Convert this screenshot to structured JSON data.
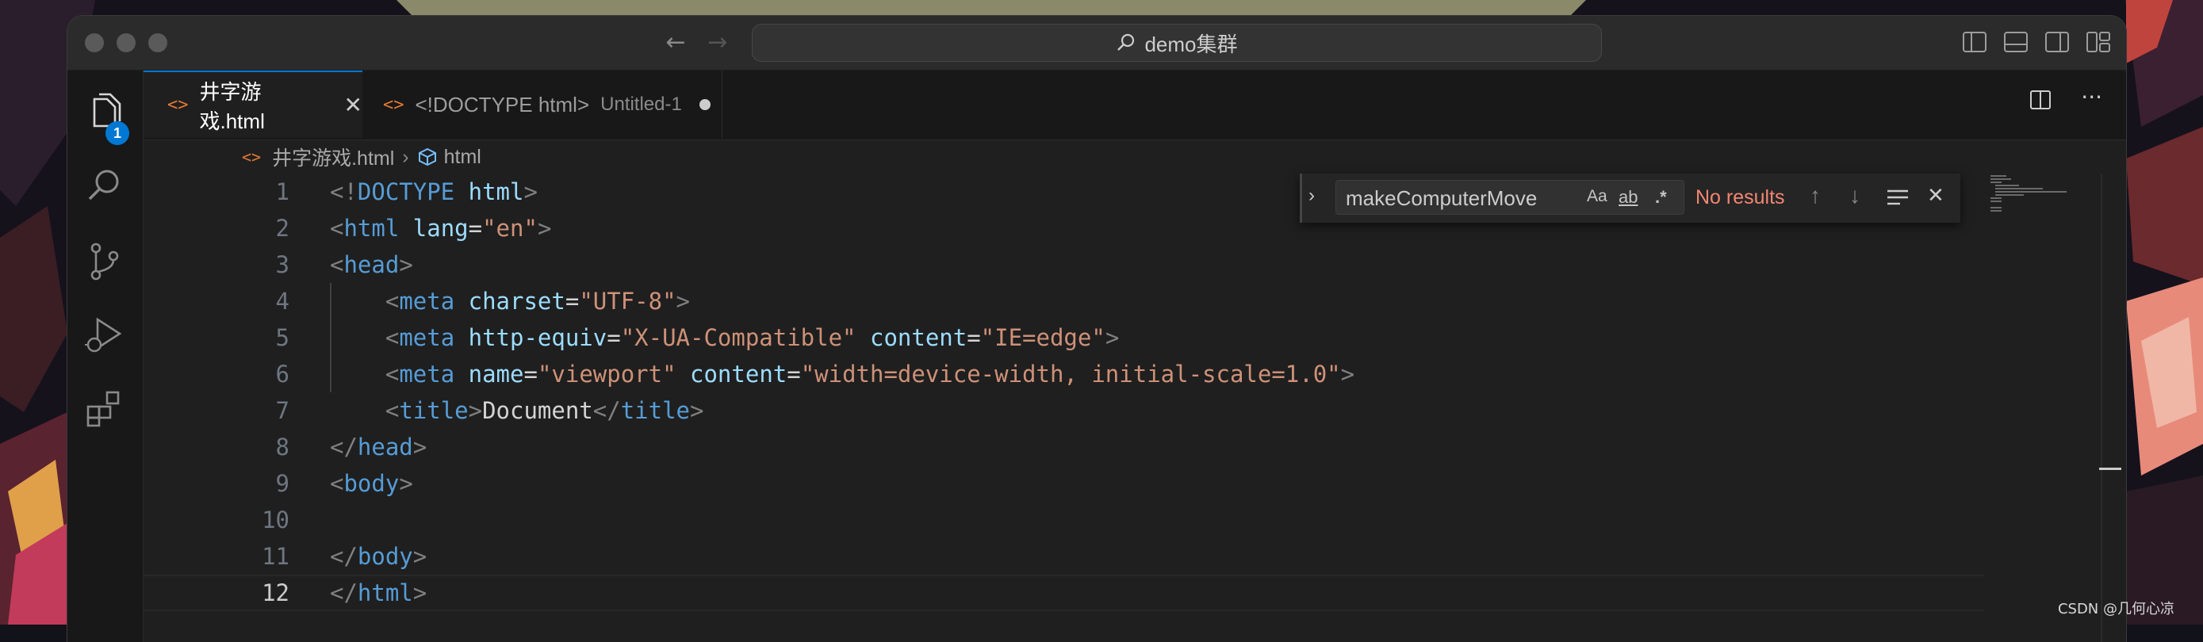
{
  "titlebar": {
    "search_text": "demo集群"
  },
  "activity_bar": {
    "explorer_badge": "1"
  },
  "tabs": [
    {
      "label": "井字游戏.html",
      "active": true,
      "dirty": false
    },
    {
      "label": "<!DOCTYPE html>",
      "description": "Untitled-1",
      "active": false,
      "dirty": true
    }
  ],
  "breadcrumb": {
    "file": "井字游戏.html",
    "symbol": "html"
  },
  "editor": {
    "line_numbers": [
      "1",
      "2",
      "3",
      "4",
      "5",
      "6",
      "7",
      "8",
      "9",
      "10",
      "11",
      "12"
    ],
    "current_line": "12",
    "lines": [
      [
        [
          "punc",
          "<!"
        ],
        [
          "tag",
          "DOCTYPE"
        ],
        [
          "text",
          " "
        ],
        [
          "attr",
          "html"
        ],
        [
          "punc",
          ">"
        ]
      ],
      [
        [
          "punc",
          "<"
        ],
        [
          "tag",
          "html"
        ],
        [
          "text",
          " "
        ],
        [
          "attr",
          "lang"
        ],
        [
          "text",
          "="
        ],
        [
          "str",
          "\"en\""
        ],
        [
          "punc",
          ">"
        ]
      ],
      [
        [
          "punc",
          "<"
        ],
        [
          "tag",
          "head"
        ],
        [
          "punc",
          ">"
        ]
      ],
      [
        [
          "text",
          "    "
        ],
        [
          "punc",
          "<"
        ],
        [
          "tag",
          "meta"
        ],
        [
          "text",
          " "
        ],
        [
          "attr",
          "charset"
        ],
        [
          "text",
          "="
        ],
        [
          "str",
          "\"UTF-8\""
        ],
        [
          "punc",
          ">"
        ]
      ],
      [
        [
          "text",
          "    "
        ],
        [
          "punc",
          "<"
        ],
        [
          "tag",
          "meta"
        ],
        [
          "text",
          " "
        ],
        [
          "attr",
          "http-equiv"
        ],
        [
          "text",
          "="
        ],
        [
          "str",
          "\"X-UA-Compatible\""
        ],
        [
          "text",
          " "
        ],
        [
          "attr",
          "content"
        ],
        [
          "text",
          "="
        ],
        [
          "str",
          "\"IE=edge\""
        ],
        [
          "punc",
          ">"
        ]
      ],
      [
        [
          "text",
          "    "
        ],
        [
          "punc",
          "<"
        ],
        [
          "tag",
          "meta"
        ],
        [
          "text",
          " "
        ],
        [
          "attr",
          "name"
        ],
        [
          "text",
          "="
        ],
        [
          "str",
          "\"viewport\""
        ],
        [
          "text",
          " "
        ],
        [
          "attr",
          "content"
        ],
        [
          "text",
          "="
        ],
        [
          "str",
          "\"width=device-width, initial-scale=1.0\""
        ],
        [
          "punc",
          ">"
        ]
      ],
      [
        [
          "text",
          "    "
        ],
        [
          "punc",
          "<"
        ],
        [
          "tag",
          "title"
        ],
        [
          "punc",
          ">"
        ],
        [
          "text",
          "Document"
        ],
        [
          "punc",
          "</"
        ],
        [
          "tag",
          "title"
        ],
        [
          "punc",
          ">"
        ]
      ],
      [
        [
          "punc",
          "</"
        ],
        [
          "tag",
          "head"
        ],
        [
          "punc",
          ">"
        ]
      ],
      [
        [
          "punc",
          "<"
        ],
        [
          "tag",
          "body"
        ],
        [
          "punc",
          ">"
        ]
      ],
      [],
      [
        [
          "punc",
          "</"
        ],
        [
          "tag",
          "body"
        ],
        [
          "punc",
          ">"
        ]
      ],
      [
        [
          "punc",
          "</"
        ],
        [
          "tag",
          "html"
        ],
        [
          "punc",
          ">"
        ]
      ]
    ]
  },
  "find_widget": {
    "query": "makeComputerMove",
    "match_case_label": "Aa",
    "whole_word_label": "ab",
    "regex_label": ".*",
    "result_text": "No results"
  },
  "watermark": "CSDN @几何心凉",
  "colors": {
    "accent": "#0078d4",
    "file_icon": "#e37933",
    "no_results": "#f48771",
    "tag": "#569cd6",
    "attr": "#9cdcfe",
    "string": "#ce9178"
  },
  "icons": {
    "explorer": "files-icon",
    "search": "search-icon",
    "scm": "source-control-icon",
    "debug": "run-debug-icon",
    "extensions": "extensions-icon"
  }
}
